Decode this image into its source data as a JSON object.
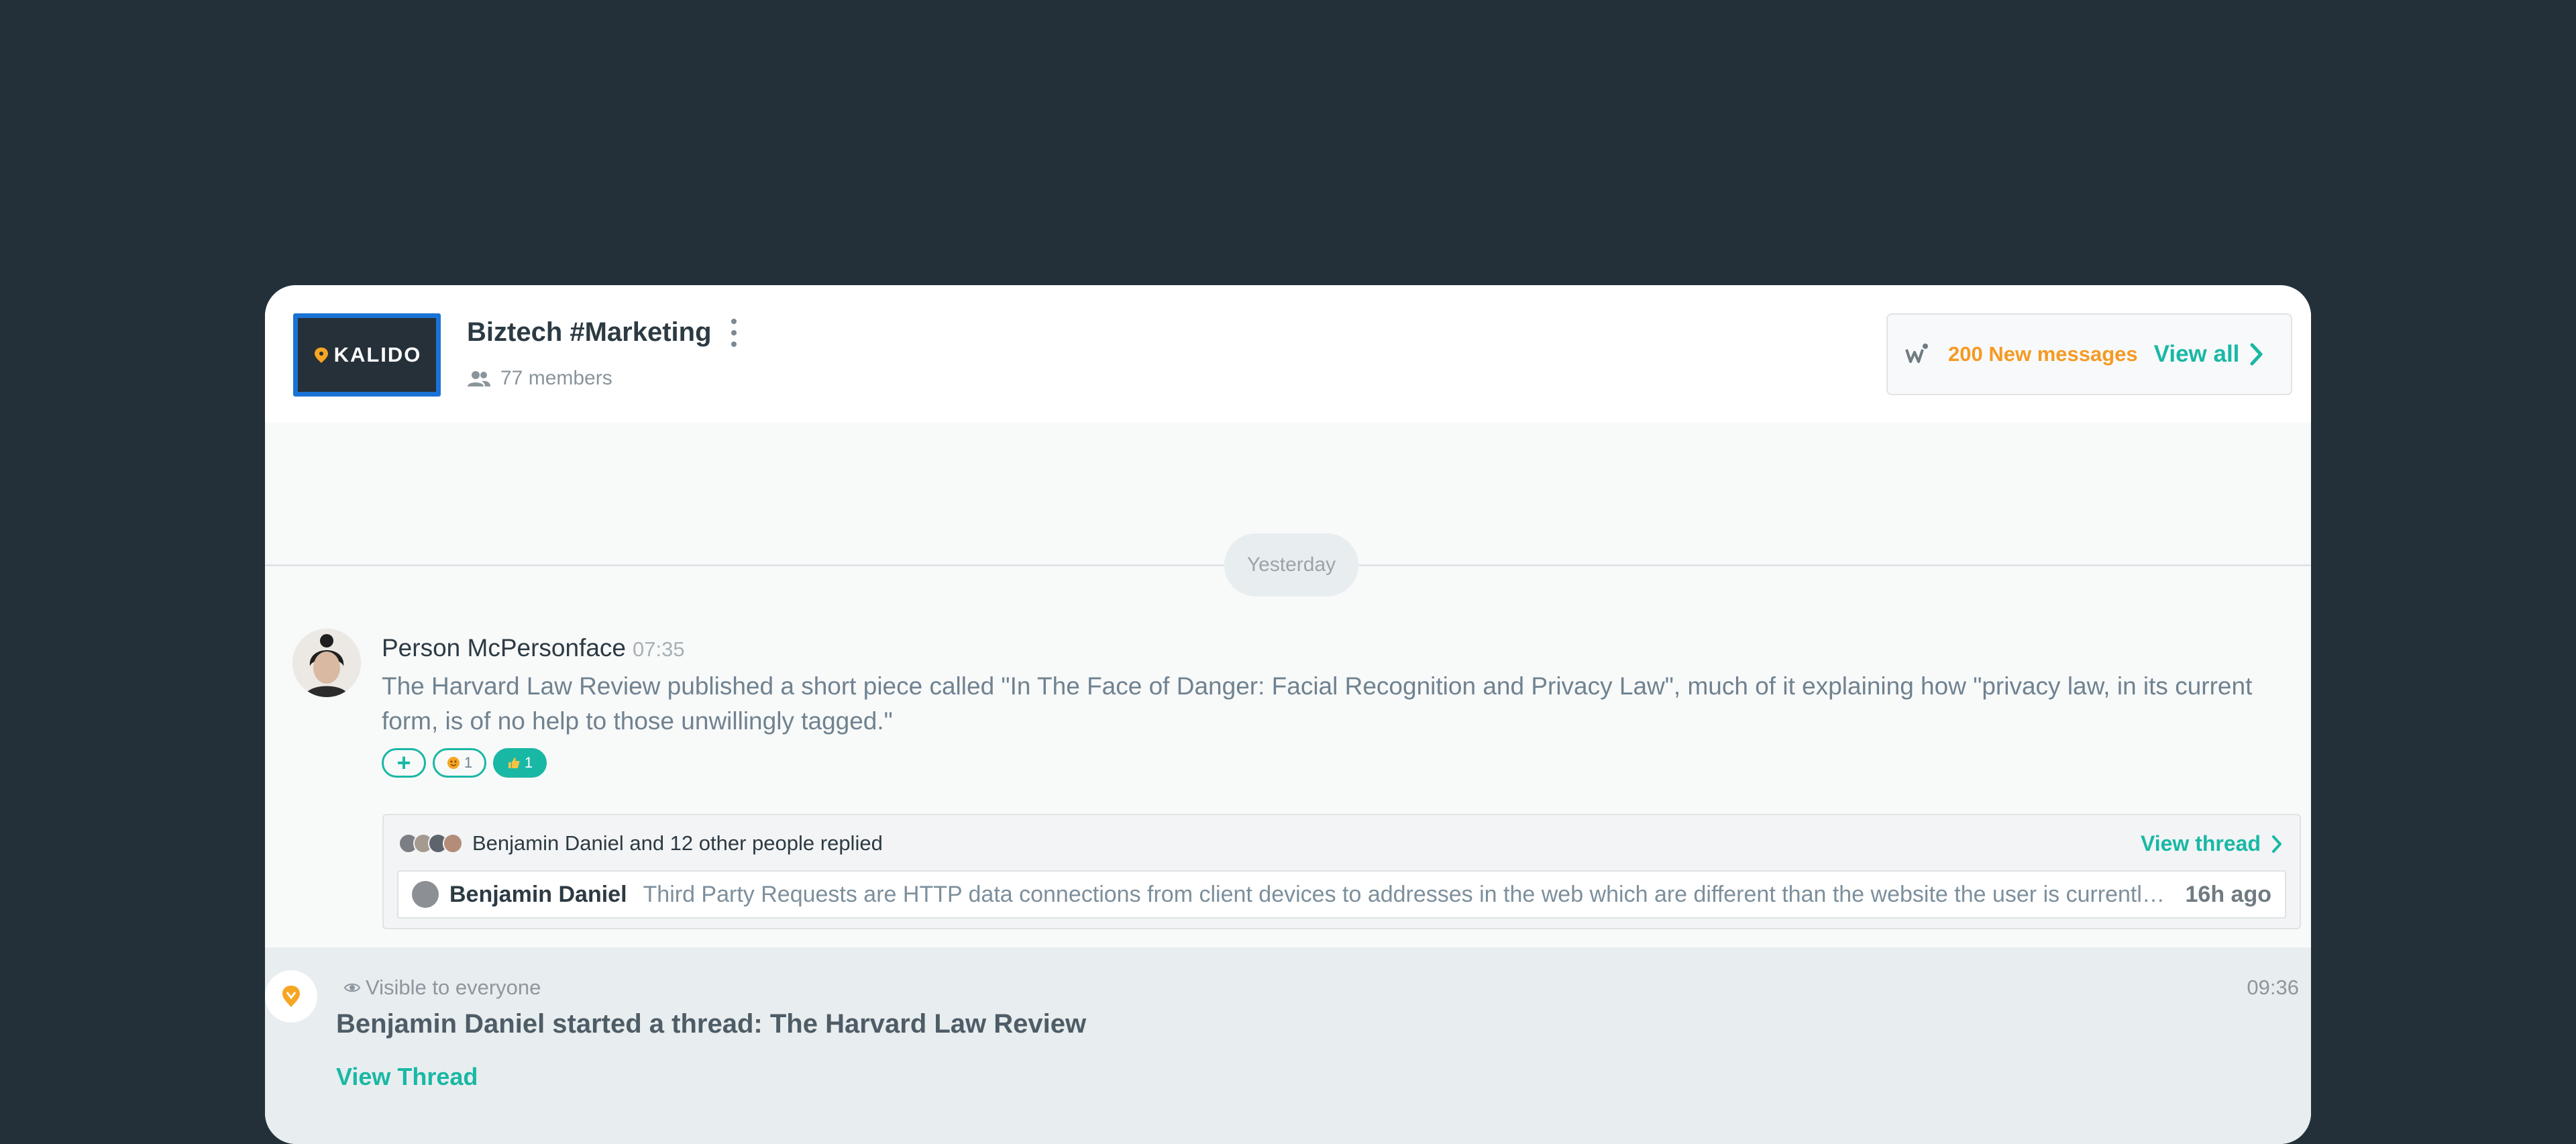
{
  "header": {
    "logo_text": "KALIDO",
    "channel_name": "Biztech #Marketing",
    "members": "77 members",
    "new_messages": "200 New messages",
    "view_all": "View all"
  },
  "feed": {
    "date_divider": "Yesterday",
    "message": {
      "author": "Person McPersonface",
      "time": "07:35",
      "text": "The Harvard Law Review published a short piece called \"In The Face of Danger: Facial Recognition and Privacy Law\", much of it explaining how \"privacy law, in its current form, is of no help to those unwillingly tagged.\"",
      "reactions": [
        {
          "icon": "plus",
          "label": "+"
        },
        {
          "icon": "emoji-face",
          "count": "1"
        },
        {
          "icon": "thumbs-up",
          "count": "1"
        }
      ]
    },
    "thread": {
      "summary": "Benjamin Daniel and 12 other people replied",
      "view_thread": "View thread",
      "reply_author": "Benjamin Daniel",
      "reply_text": "Third Party Requests are HTTP data connections from client devices to addresses in the web which are different than the website the user is currently visiting",
      "reply_time": "16h ago"
    },
    "notice": {
      "visibility": "Visible to everyone",
      "time": "09:36",
      "title": "Benjamin Daniel started a thread: The Harvard Law Review",
      "link": "View Thread"
    }
  },
  "colors": {
    "background": "#243039",
    "accent": "#19b8a5",
    "highlight": "#f59a23"
  }
}
